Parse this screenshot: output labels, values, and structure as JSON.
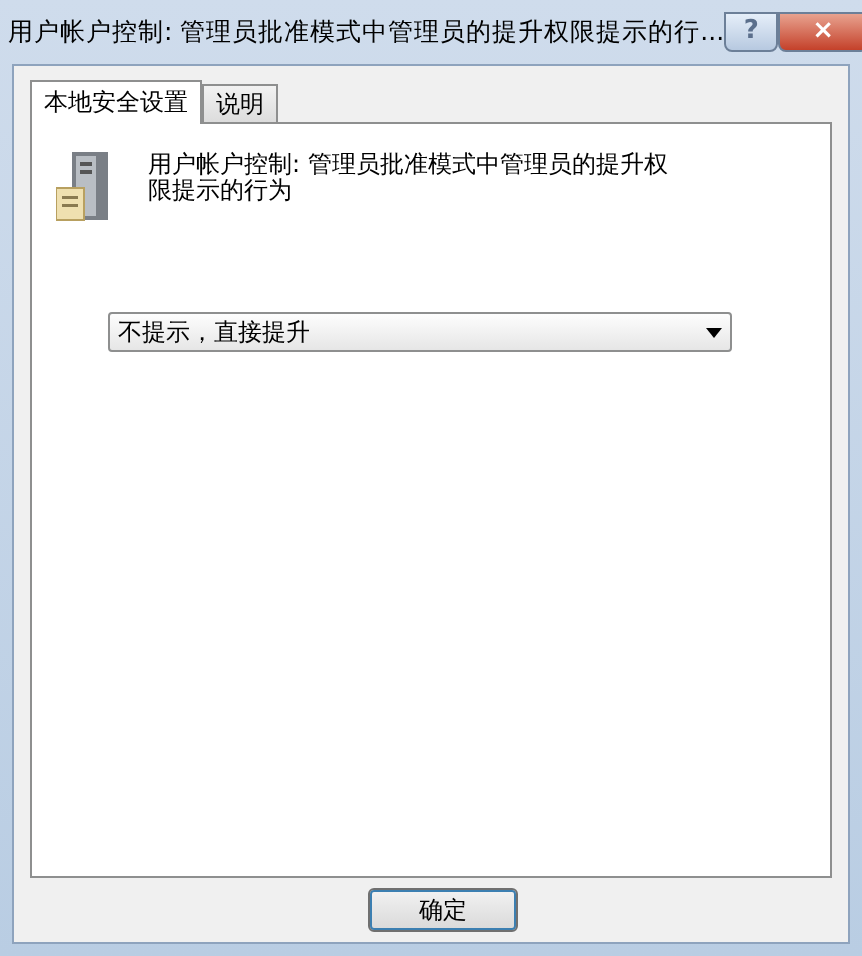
{
  "window": {
    "title": "用户帐户控制: 管理员批准模式中管理员的提升权限提示的行...",
    "help_button": "?",
    "close_button": "×"
  },
  "tabs": [
    {
      "label": "本地安全设置",
      "selected": true
    },
    {
      "label": "说明",
      "selected": false
    }
  ],
  "policy": {
    "description": "用户帐户控制: 管理员批准模式中管理员的提升权限提示的行为"
  },
  "dropdown": {
    "value": "不提示，直接提升"
  },
  "buttons": [
    "确定"
  ]
}
